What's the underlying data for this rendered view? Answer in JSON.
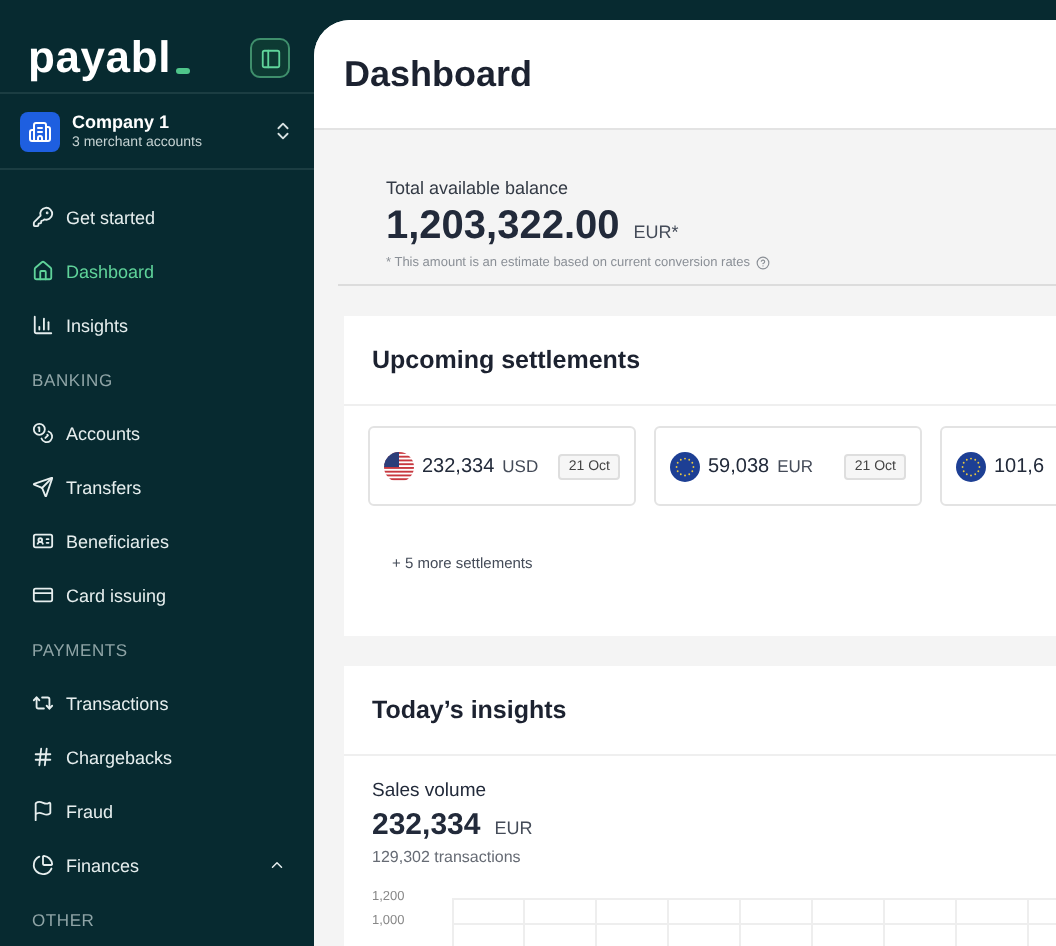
{
  "sidebar": {
    "logo": "payabl",
    "company": {
      "name": "Company 1",
      "subtitle": "3 merchant accounts"
    },
    "items": [
      {
        "kind": "item",
        "label": "Get started",
        "selected": false
      },
      {
        "kind": "item",
        "label": "Dashboard",
        "selected": true
      },
      {
        "kind": "item",
        "label": "Insights",
        "selected": false
      },
      {
        "kind": "section",
        "label": "BANKING"
      },
      {
        "kind": "item",
        "label": "Accounts",
        "selected": false
      },
      {
        "kind": "item",
        "label": "Transfers",
        "selected": false
      },
      {
        "kind": "item",
        "label": "Beneficiaries",
        "selected": false
      },
      {
        "kind": "item",
        "label": "Card issuing",
        "selected": false
      },
      {
        "kind": "section",
        "label": "PAYMENTS"
      },
      {
        "kind": "item",
        "label": "Transactions",
        "selected": false
      },
      {
        "kind": "item",
        "label": "Chargebacks",
        "selected": false
      },
      {
        "kind": "item",
        "label": "Fraud",
        "selected": false
      },
      {
        "kind": "group",
        "label": "Finances",
        "selected": false,
        "expanded": true
      },
      {
        "kind": "section",
        "label": "OTHER"
      }
    ]
  },
  "header": {
    "title": "Dashboard"
  },
  "balance": {
    "label": "Total available balance",
    "amount": "1,203,322.00",
    "currency": "EUR*",
    "note": "* This amount is an estimate based on current conversion rates"
  },
  "settlements": {
    "title": "Upcoming settlements",
    "cards": [
      {
        "kind": "us",
        "amount": "232,334",
        "currency": "USD",
        "date": "21 Oct"
      },
      {
        "kind": "eu",
        "amount": "59,038",
        "currency": "EUR",
        "date": "21 Oct"
      },
      {
        "kind": "eu",
        "amount": "101,6"
      }
    ],
    "more": "+ 5 more settlements"
  },
  "insights": {
    "title": "Today’s insights",
    "metric": {
      "label": "Sales volume",
      "value": "232,334",
      "currency": "EUR",
      "sub": "129,302 transactions"
    },
    "axis_labels": [
      "1,200",
      "1,000"
    ]
  }
}
